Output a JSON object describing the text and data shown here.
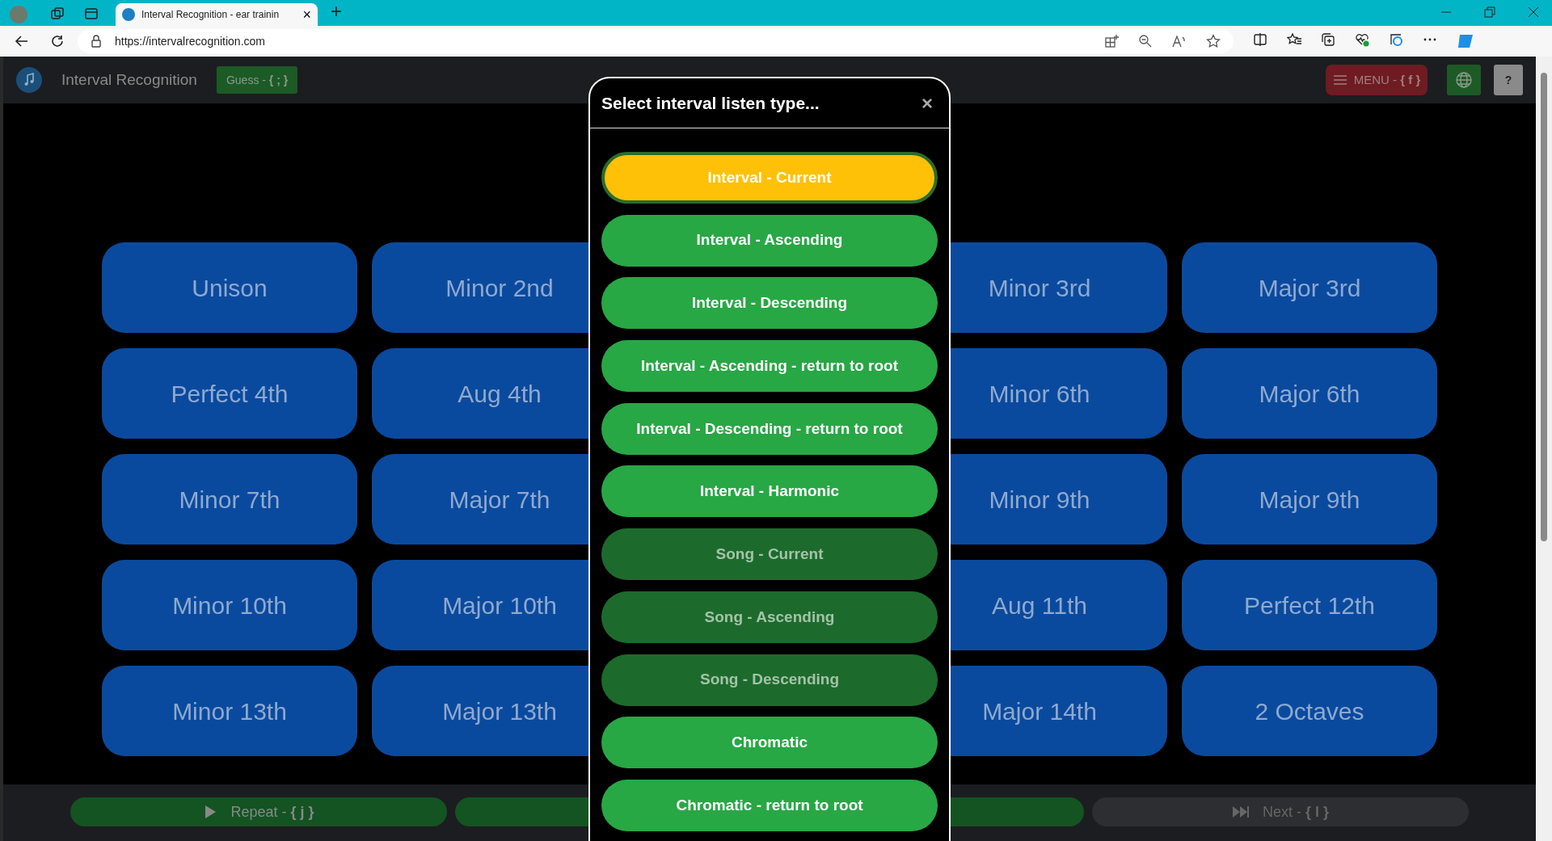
{
  "browser": {
    "tab_title": "Interval Recognition - ear trainin",
    "tab_close": "×",
    "new_tab": "+",
    "url": "https://intervalrecognition.com"
  },
  "app": {
    "title": "Interval Recognition",
    "guess_button": "Guess - **{ ; }**",
    "menu_button": "MENU - **{ f }**",
    "help_button": "?"
  },
  "intervals": [
    {
      "label": "Unison"
    },
    {
      "label": "Minor 2nd"
    },
    {
      "label": "Minor 3rd"
    },
    {
      "label": "Major 3rd"
    },
    {
      "label": "Perfect 4th"
    },
    {
      "label": "Aug 4th"
    },
    {
      "label": "Minor 6th"
    },
    {
      "label": "Major 6th"
    },
    {
      "label": "Minor 7th"
    },
    {
      "label": "Major 7th"
    },
    {
      "label": "Minor 9th"
    },
    {
      "label": "Major 9th"
    },
    {
      "label": "Minor 10th"
    },
    {
      "label": "Major 10th"
    },
    {
      "label": "Aug 11th"
    },
    {
      "label": "Perfect 12th"
    },
    {
      "label": "Minor 13th"
    },
    {
      "label": "Major 13th"
    },
    {
      "label": "Major 14th"
    },
    {
      "label": "2 Octaves"
    }
  ],
  "bottom_bar": {
    "repeat_button": "Repeat - **{ j }**",
    "next_button": "Next - **{ l }**"
  },
  "modal": {
    "title": "Select interval listen type...",
    "close": "×",
    "options": [
      {
        "label": "Interval - Current",
        "selected": true,
        "disabled": false
      },
      {
        "label": "Interval - Ascending",
        "selected": false,
        "disabled": false
      },
      {
        "label": "Interval - Descending",
        "selected": false,
        "disabled": false
      },
      {
        "label": "Interval - Ascending - return to root",
        "selected": false,
        "disabled": false
      },
      {
        "label": "Interval - Descending - return to root",
        "selected": false,
        "disabled": false
      },
      {
        "label": "Interval - Harmonic",
        "selected": false,
        "disabled": false
      },
      {
        "label": "Song - Current",
        "selected": false,
        "disabled": true
      },
      {
        "label": "Song - Ascending",
        "selected": false,
        "disabled": true
      },
      {
        "label": "Song - Descending",
        "selected": false,
        "disabled": true
      },
      {
        "label": "Chromatic",
        "selected": false,
        "disabled": false
      },
      {
        "label": "Chromatic - return to root",
        "selected": false,
        "disabled": false
      }
    ]
  }
}
